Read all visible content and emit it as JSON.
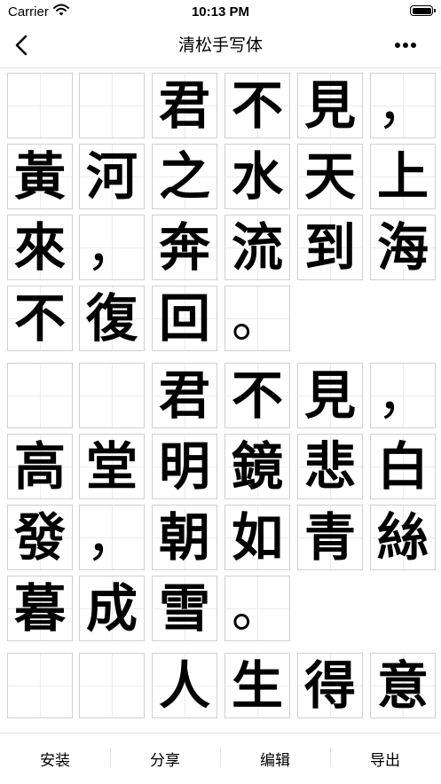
{
  "status_bar": {
    "carrier": "Carrier",
    "time": "10:13 PM"
  },
  "nav": {
    "title": "清松手写体",
    "back_icon": "chevron-left-icon",
    "more_icon": "ellipsis-icon"
  },
  "stanzas": [
    {
      "rows": [
        [
          "",
          "",
          "君",
          "不",
          "見",
          "，"
        ],
        [
          "黃",
          "河",
          "之",
          "水",
          "天",
          "上"
        ],
        [
          "來",
          "，",
          "奔",
          "流",
          "到",
          "海"
        ],
        [
          "不",
          "復",
          "回",
          "。",
          "",
          ""
        ]
      ]
    },
    {
      "rows": [
        [
          "",
          "",
          "君",
          "不",
          "見",
          "，"
        ],
        [
          "高",
          "堂",
          "明",
          "鏡",
          "悲",
          "白"
        ],
        [
          "發",
          "，",
          "朝",
          "如",
          "青",
          "絲"
        ],
        [
          "暮",
          "成",
          "雪",
          "。",
          "",
          ""
        ]
      ]
    },
    {
      "rows": [
        [
          "",
          "",
          "人",
          "生",
          "得",
          "意"
        ]
      ]
    }
  ],
  "toolbar": {
    "install": "安装",
    "share": "分享",
    "edit": "编辑",
    "export": "导出"
  }
}
